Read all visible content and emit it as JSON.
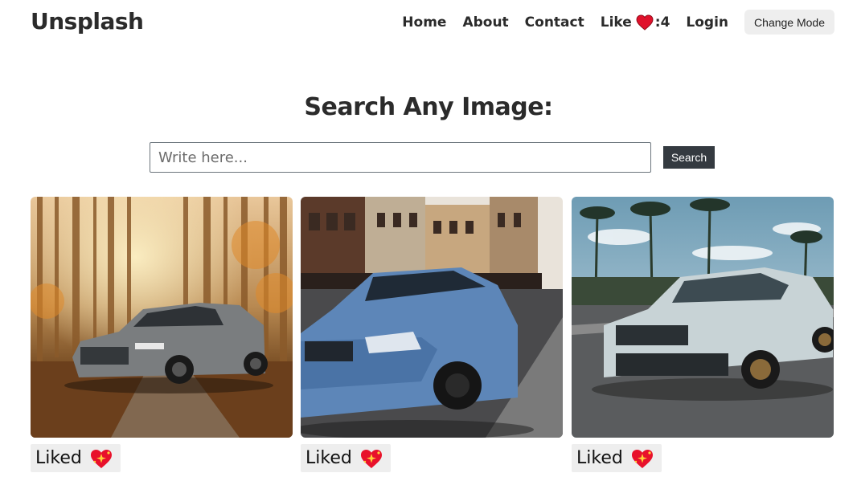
{
  "navbar": {
    "brand": "Unsplash",
    "links": {
      "home": "Home",
      "about": "About",
      "contact": "Contact",
      "like": "Like",
      "like_count": ":4",
      "login": "Login"
    },
    "change_mode": "Change Mode",
    "like_icon": "heart-icon"
  },
  "search": {
    "title": "Search Any Image:",
    "placeholder": "Write here...",
    "button": "Search"
  },
  "cards": [
    {
      "image": "grey car in autumn forest",
      "liked_label": "Liked",
      "icon": "sparkling-heart-icon"
    },
    {
      "image": "blue car on city street",
      "liked_label": "Liked",
      "icon": "sparkling-heart-icon"
    },
    {
      "image": "white sedan driving under palm trees",
      "liked_label": "Liked",
      "icon": "sparkling-heart-icon"
    }
  ],
  "colors": {
    "heart": "#e0112b",
    "search_button": "#343a40",
    "chip_bg": "#eeeeee"
  }
}
